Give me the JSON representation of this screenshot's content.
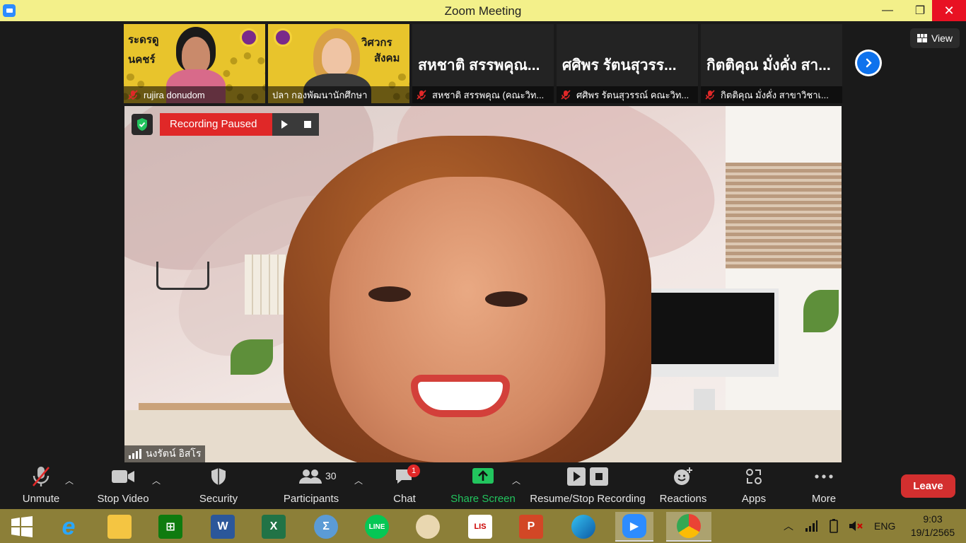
{
  "window": {
    "title": "Zoom Meeting",
    "minimize": "—",
    "maximize": "❐",
    "close": "✕"
  },
  "thumbnails": [
    {
      "name": "rujira donudom",
      "has_video": true,
      "poster_left": "ระดรดู",
      "poster_right": "นคชร์"
    },
    {
      "name": "ปลา กองพัฒนานักศึกษา",
      "has_video": true,
      "poster_left": "วิศวกร",
      "poster_right": "สังคม"
    },
    {
      "name": "สหชาติ สรรพคุณ (คณะวิท...",
      "big_name": "สหชาติ สรรพคุณ...",
      "has_video": false
    },
    {
      "name": "ศศิพร รัตนสุวรรณ์ คณะวิท...",
      "big_name": "ศศิพร รัตนสุวรร...",
      "has_video": false
    },
    {
      "name": "กิตติคุณ  มั่งคั่ง สาขาวิชาเ...",
      "big_name": "กิตติคุณ  มั่งคั่ง สา...",
      "has_video": false
    }
  ],
  "view_button": "View",
  "recording": {
    "status": "Recording Paused"
  },
  "active_speaker": {
    "name": "นงรัตน์ อิสโร"
  },
  "toolbar": {
    "unmute": "Unmute",
    "stop_video": "Stop Video",
    "security": "Security",
    "participants": "Participants",
    "participants_count": "30",
    "chat": "Chat",
    "chat_badge": "1",
    "share_screen": "Share Screen",
    "recording": "Resume/Stop Recording",
    "reactions": "Reactions",
    "apps": "Apps",
    "more": "More",
    "leave": "Leave"
  },
  "taskbar": {
    "apps": [
      "windows-start",
      "internet-explorer",
      "file-explorer",
      "store",
      "word",
      "excel",
      "math-input",
      "line",
      "paint",
      "lisrel",
      "powerpoint",
      "edge",
      "zoom",
      "chrome"
    ],
    "language": "ENG",
    "time": "9:03",
    "date": "19/1/2565"
  },
  "colors": {
    "titlebar": "#f3f08a",
    "accent": "#0e72ed",
    "leave": "#d32f2f",
    "share": "#22c55e",
    "recording": "#e02828"
  }
}
